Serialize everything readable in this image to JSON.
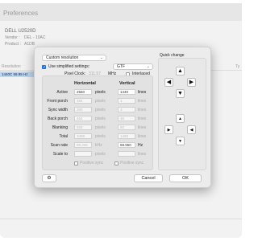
{
  "background": {
    "title": "Preferences",
    "display_name": "DELL U2520D",
    "vendor_label": "Vendor :",
    "vendor_value": "DEL - 10AC",
    "product_label": "Product :",
    "product_value": "A1DB",
    "table_headers": [
      "Resolution",
      "",
      "Ty"
    ],
    "selected_row": "1440C 59.95 Hz"
  },
  "dialog": {
    "mode_select": "Custom resolution",
    "use_simplified_label": "Use simplified settings:",
    "use_simplified_checked": true,
    "timing_select": "GTF",
    "pixel_clock_label": "Pixel Clock:",
    "pixel_clock_value": "311.57",
    "pixel_clock_unit": "MHz",
    "interlaced_label": "Interlaced",
    "interlaced_checked": false,
    "horizontal_header": "Horizontal",
    "vertical_header": "Vertical",
    "rows": [
      {
        "label": "Active",
        "h": "2560",
        "h_unit": "pixels",
        "v": "1440",
        "v_unit": "lines",
        "h_dim": false,
        "v_dim": false
      },
      {
        "label": "Front porch",
        "h": "184",
        "h_unit": "pixels",
        "v": "1",
        "v_unit": "lines",
        "h_dim": true,
        "v_dim": true
      },
      {
        "label": "Sync width",
        "h": "280",
        "h_unit": "pixels",
        "v": "3",
        "v_unit": "lines",
        "h_dim": true,
        "v_dim": true
      },
      {
        "label": "Back porch",
        "h": "464",
        "h_unit": "pixels",
        "v": "46",
        "v_unit": "lines",
        "h_dim": true,
        "v_dim": true
      },
      {
        "label": "Blanking",
        "h": "928",
        "h_unit": "pixels",
        "v": "50",
        "v_unit": "lines",
        "h_dim": true,
        "v_dim": true
      },
      {
        "label": "Total",
        "h": "3488",
        "h_unit": "pixels",
        "v": "1490",
        "v_unit": "lines",
        "h_dim": true,
        "v_dim": true
      },
      {
        "label": "Scan rate",
        "h": "89.326",
        "h_unit": "kHz",
        "v": "59.950",
        "v_unit": "Hz",
        "h_dim": true,
        "v_dim": false
      },
      {
        "label": "Scale to",
        "h": "",
        "h_unit": "pixels",
        "v": "",
        "v_unit": "lines",
        "h_dim": true,
        "v_dim": true
      }
    ],
    "h_sync_label": "Positive sync",
    "v_sync_label": "Positive sync",
    "quick_change_title": "Quick change",
    "cancel_label": "Cancel",
    "ok_label": "OK"
  },
  "icons": {
    "up": "▲",
    "down": "▼",
    "left": "◀",
    "right": "▶",
    "gear": "⚙",
    "chevron": "⌄",
    "check": "✓"
  },
  "colors": {
    "accent": "#1e6fe0",
    "selection": "#bcd7f2"
  }
}
